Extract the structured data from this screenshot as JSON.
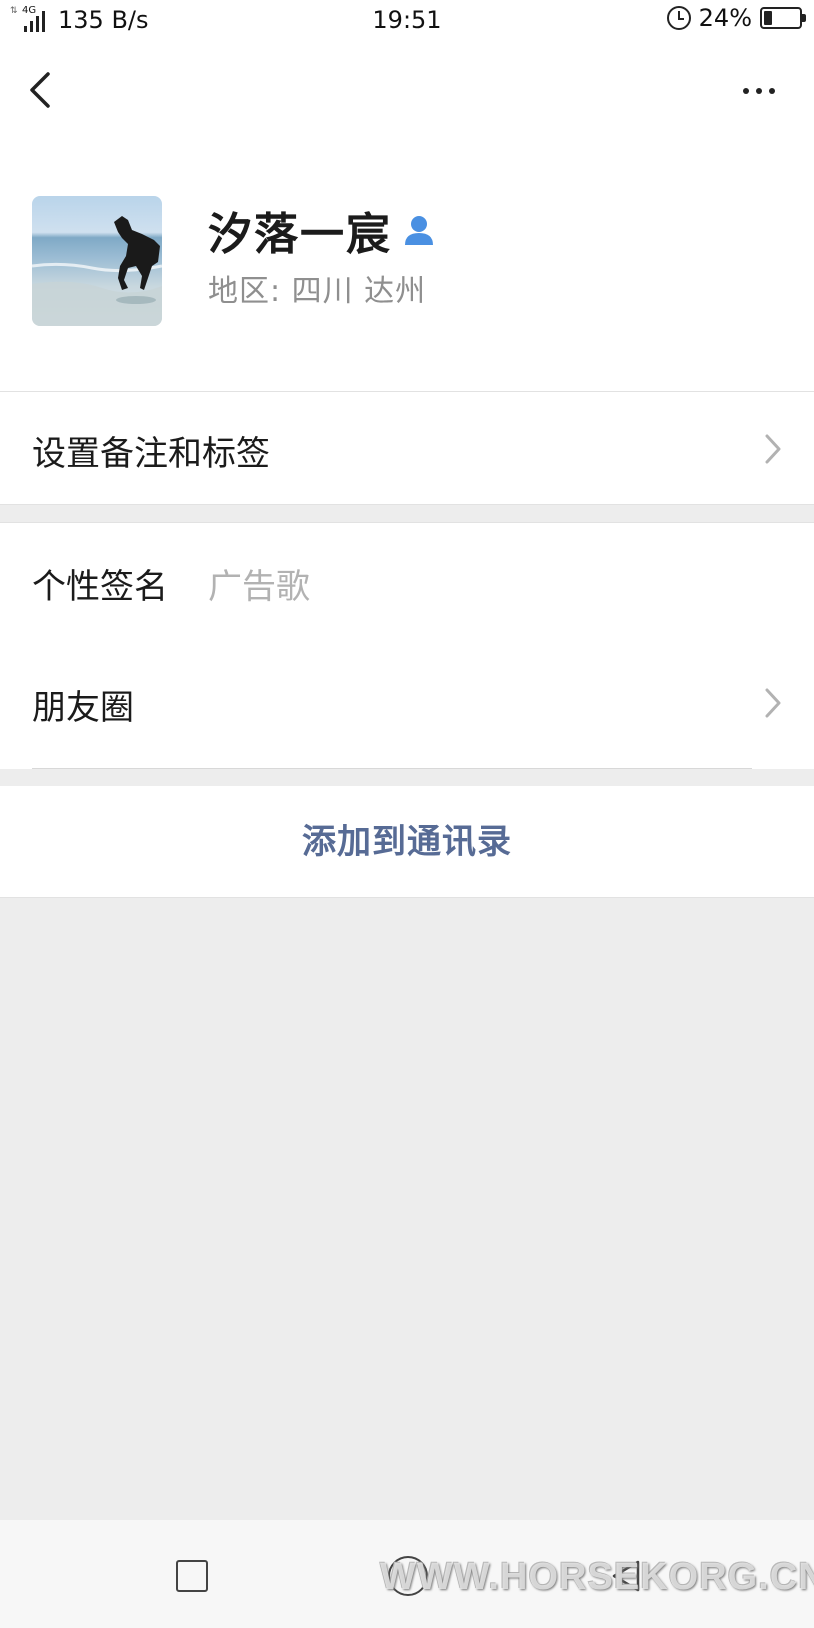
{
  "status_bar": {
    "network_type": "4G",
    "speed": "135 B/s",
    "time": "19:51",
    "battery_percent": "24%",
    "battery_level": 0.24
  },
  "nav": {
    "back_icon": "chevron-left-icon",
    "more_icon": "more-dots-icon"
  },
  "profile": {
    "name": "汐落一宸",
    "region": "地区:  四川  达州",
    "contact_icon_color": "#4a90e2"
  },
  "rows": {
    "remark_label": "设置备注和标签",
    "signature_label": "个性签名",
    "signature_value": "广告歌",
    "moments_label": "朋友圈"
  },
  "actions": {
    "add_contact": "添加到通讯录",
    "accent_color": "#576b95"
  },
  "watermark": "WWW.HORSEKORG.CN"
}
